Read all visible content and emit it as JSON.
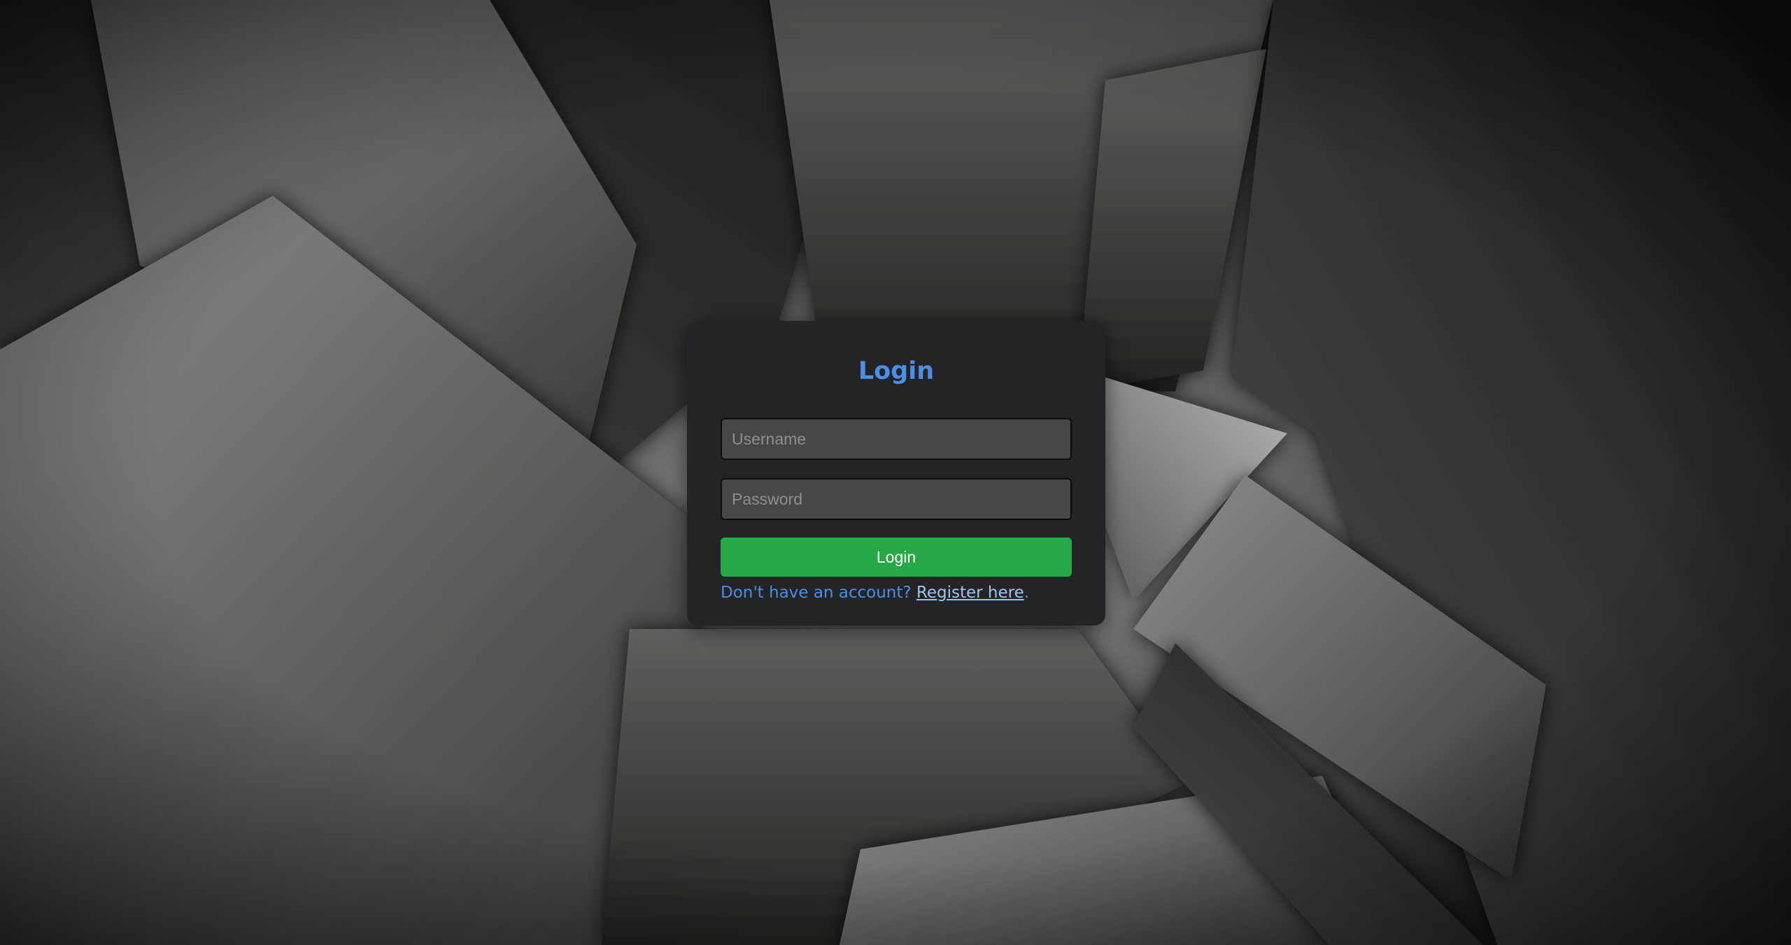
{
  "login": {
    "title": "Login",
    "username_placeholder": "Username",
    "password_placeholder": "Password",
    "submit_label": "Login",
    "register_prompt": "Don't have an account? ",
    "register_link": "Register here",
    "register_suffix": "."
  },
  "colors": {
    "accent": "#4a8ee8",
    "button": "#27a745",
    "card": "#242427"
  },
  "background": {
    "style": "dark grey concrete texture with overlapping angular slabs"
  }
}
